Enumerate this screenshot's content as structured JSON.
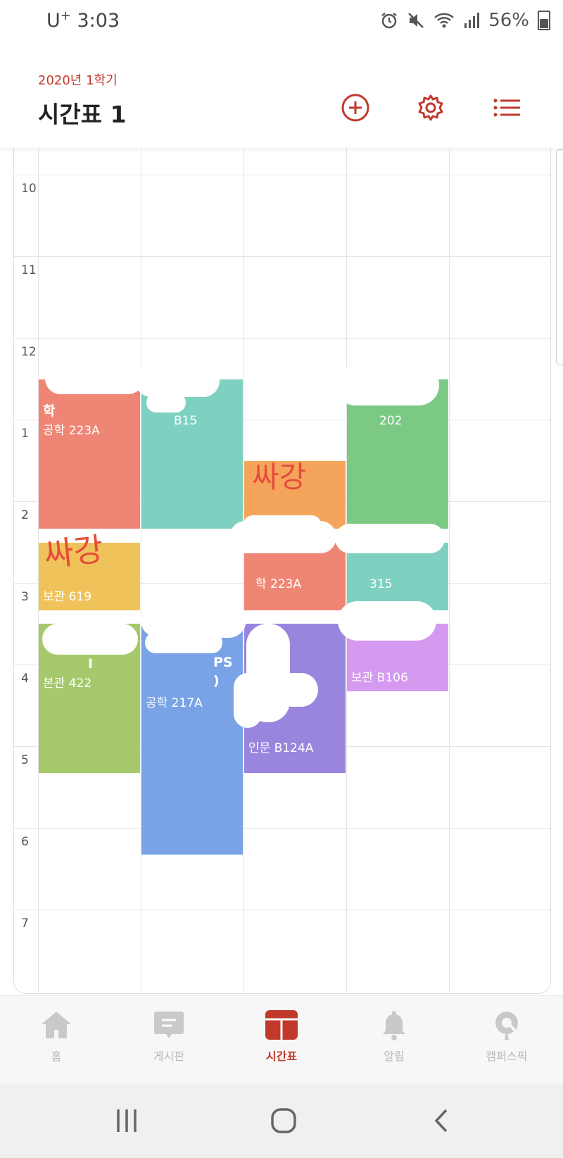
{
  "status_bar": {
    "carrier": "U",
    "carrier_sup": "+",
    "time": "3:03",
    "battery": "56%"
  },
  "header": {
    "semester": "2020년 1학기",
    "title": "시간표 1",
    "add_icon": "plus-circle-icon",
    "settings_icon": "gear-icon",
    "list_icon": "list-icon",
    "accent_color": "#c0392b"
  },
  "timetable": {
    "hours": [
      "10",
      "11",
      "12",
      "1",
      "2",
      "3",
      "4",
      "5",
      "6",
      "7"
    ],
    "courses": [
      {
        "name": "학",
        "room": "공학 223A",
        "color": "#ef8575"
      },
      {
        "name": "",
        "room": "B15",
        "color": "#7ed1c1"
      },
      {
        "name": "",
        "room": "202",
        "color": "#7cc983"
      },
      {
        "name": "",
        "room": "",
        "color": "#f5a55b"
      },
      {
        "name": "",
        "room": "보관 619",
        "color": "#f0c35a"
      },
      {
        "name": "",
        "room": "학 223A",
        "color": "#ef8575"
      },
      {
        "name": "",
        "room": "315",
        "color": "#7ed1c1"
      },
      {
        "name": "I",
        "room": "본관 422",
        "color": "#a5c96b"
      },
      {
        "name": "PS )",
        "room": "공학 217A",
        "color": "#79a3e6"
      },
      {
        "name": "",
        "room": "인문 B124A",
        "color": "#9a85de"
      },
      {
        "name": "",
        "room": "보관 B106",
        "color": "#d59af0"
      }
    ],
    "scribble_text": [
      "싸강",
      "싸강"
    ]
  },
  "bottom_nav": {
    "items": [
      {
        "label": "홈",
        "icon": "home-icon"
      },
      {
        "label": "게시판",
        "icon": "board-icon"
      },
      {
        "label": "시간표",
        "icon": "timetable-icon"
      },
      {
        "label": "알림",
        "icon": "bell-icon"
      },
      {
        "label": "캠퍼스픽",
        "icon": "campuspick-icon"
      }
    ],
    "active_color": "#c0392b"
  },
  "system_nav": {
    "recents_icon": "recents-icon",
    "home_icon": "home-circle-icon",
    "back_icon": "back-icon"
  }
}
